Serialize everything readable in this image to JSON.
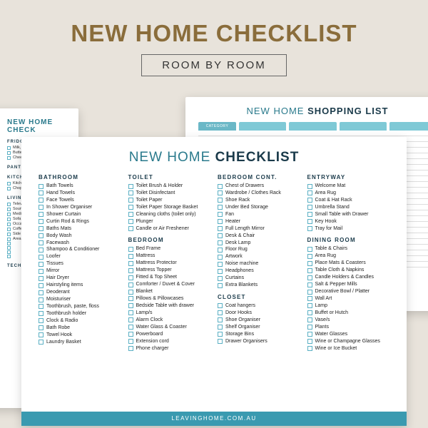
{
  "hero": {
    "title": "NEW HOME CHECKLIST",
    "subtitle": "ROOM BY ROOM"
  },
  "back_left": {
    "title": "NEW HOME CHECK",
    "sections": [
      {
        "cat": "FRIDGE STOCK",
        "items": [
          "Milk, Cow, Al",
          "Butter, Marga",
          "Cheese"
        ]
      },
      {
        "cat": "PANTRY SUPPLIES",
        "items": []
      },
      {
        "cat": "KITCHEN",
        "items": [
          "Kitchen Knives",
          "Chopping Board"
        ]
      },
      {
        "cat": "LIVING ROOM",
        "items": [
          "Television",
          "Sound Bar",
          "Media Cons",
          "Sofa",
          "Occasional",
          "Coffee Ta",
          "Side Ta",
          "Area Rug",
          "",
          "",
          "",
          ""
        ]
      },
      {
        "cat": "TECH",
        "items": []
      }
    ]
  },
  "back_right": {
    "title_a": "NEW HOME",
    "title_b": "SHOPPING LIST",
    "first_tab": "CATEGORY"
  },
  "main": {
    "title_a": "NEW HOME",
    "title_b": "CHECKLIST",
    "footer": "LEAVINGHOME.COM.AU",
    "columns": [
      [
        {
          "cat": "BATHROOM",
          "items": [
            "Bath Towels",
            "Hand Towels",
            "Face Towels",
            "In Shower Organiser",
            "Shower Curtain",
            "Curtin Rod & Rings",
            "Baths Mats",
            "Body Wash",
            "Facewash",
            "Shampoo & Conditioner",
            "Loofer",
            "Tissues",
            "Mirror",
            "Hair Dryer",
            "Hairstyling items",
            "Deoderant",
            "Moisturiser",
            "Toothbrush, paste, floss",
            "Toothbrush holder",
            "Clock & Radio",
            "Bath Robe",
            "Towel Hook",
            "Laundry Basket"
          ]
        }
      ],
      [
        {
          "cat": "TOILET",
          "items": [
            "Toilet Brush & Holder",
            "Toilet Disinfectant",
            "Toilet Paper",
            "Toilet Paper Storage Basket",
            "Cleaning cloths (toilet only)",
            "Plunger",
            "Candle or Air Freshener"
          ]
        },
        {
          "cat": "BEDROOM",
          "items": [
            "Bed Frame",
            "Mattress",
            "Mattress Protector",
            "Mattress Topper",
            "Fitted & Top Sheet",
            "Comforter / Duvet & Cover",
            "Blanket",
            "Pillows & Pillowcases",
            "Bedside Table with drawer",
            "Lamp/s",
            "Alarm Clock",
            "Water Glass & Coaster",
            "Powerboard",
            "Extension cord",
            "Phone charger"
          ]
        }
      ],
      [
        {
          "cat": "BEDROOM CONT.",
          "items": [
            "Chest of Drawers",
            "Wardrobe / Clothes Rack",
            "Shoe Rack",
            "Under Bed Storage",
            "Fan",
            "Heater",
            "Full Length Mirror",
            "Desk & Chair",
            "Desk Lamp",
            "Floor Rug",
            "Artwork",
            "Noise machine",
            "Headphones",
            "Curtains",
            "Extra Blankets"
          ]
        },
        {
          "cat": "CLOSET",
          "items": [
            "Coat hangers",
            "Door Hooks",
            "Shoe Organiser",
            "Shelf Organiser",
            "Storage Bins",
            "Drawer Organisers"
          ]
        }
      ],
      [
        {
          "cat": "ENTRYWAY",
          "items": [
            "Welcome Mat",
            "Area Rug",
            "Coat & Hat Rack",
            "Umbrella Stand",
            "Small Table with Drawer",
            "Key Hook",
            "Tray for Mail"
          ]
        },
        {
          "cat": "DINING ROOM",
          "items": [
            "Table & Chairs",
            "Area Rug",
            "Place Mats & Coasters",
            "Table Cloth & Napkins",
            "Candle Holders & Candles",
            "Salt & Pepper Mills",
            "Decorative Bowl / Platter",
            "Wall Art",
            "Lamp",
            "Buffet or Hutch",
            "Vase/s",
            "Plants",
            "Water Glasses",
            "Wine or Champagne Glasses",
            "Wine or Ice Bucket"
          ]
        }
      ]
    ]
  }
}
